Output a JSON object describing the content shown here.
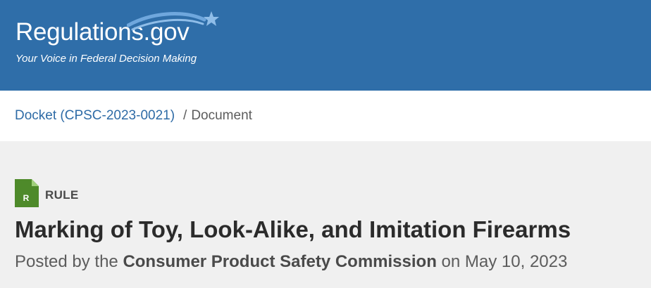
{
  "header": {
    "logo_text": "Regulations.gov",
    "tagline": "Your Voice in Federal Decision Making",
    "logo_swoosh_icon": "swoosh-star-icon"
  },
  "breadcrumb": {
    "docket_link": "Docket (CPSC-2023-0021)",
    "separator": "/",
    "current": "Document"
  },
  "document": {
    "type_icon_letter": "R",
    "type_label": "RULE",
    "title": "Marking of Toy, Look-Alike, and Imitation Firearms",
    "posted_prefix": "Posted by the",
    "agency": "Consumer Product Safety Commission",
    "posted_on": "on",
    "date": "May 10, 2023"
  },
  "colors": {
    "header_bg": "#2f6ea9",
    "link": "#2e6ba6",
    "rule_icon_green": "#4e8a2a",
    "page_bg": "#f0f0f0"
  }
}
